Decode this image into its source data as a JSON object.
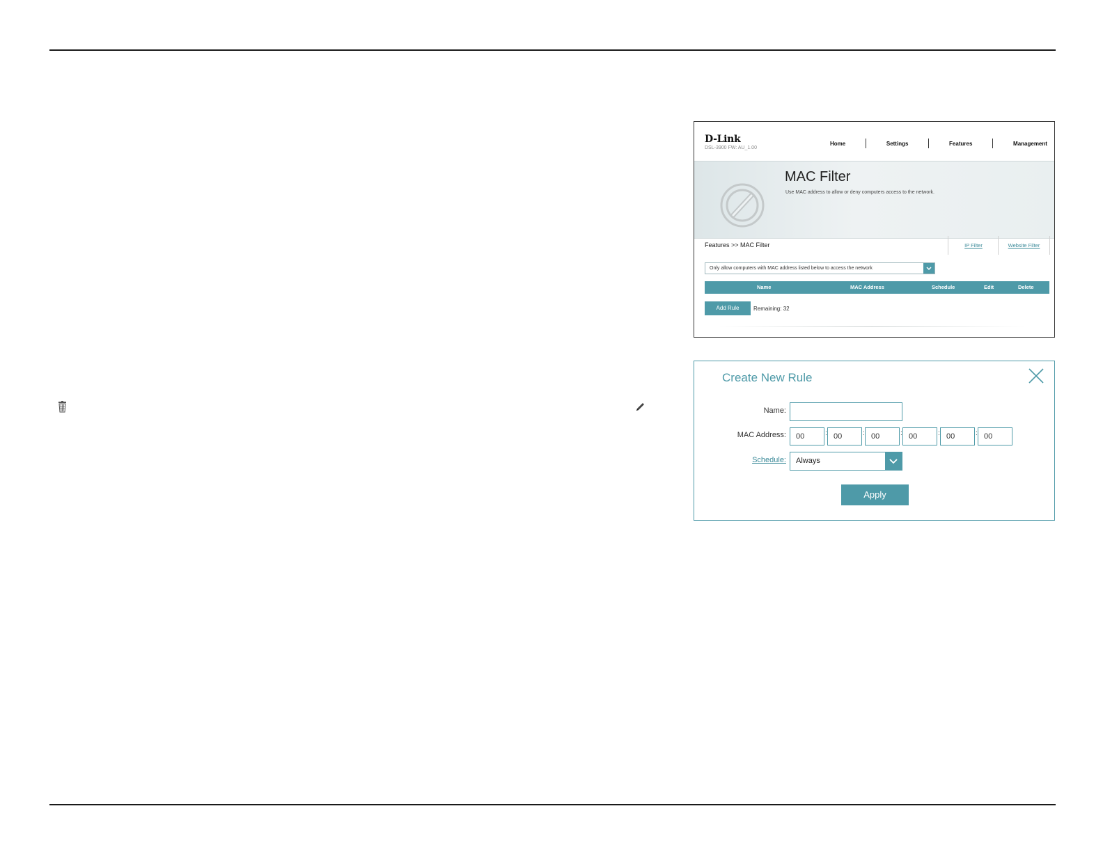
{
  "shot1": {
    "brand": "D-Link",
    "model": "DSL-3900   FW: AU_1.00",
    "nav": [
      "Home",
      "Settings",
      "Features",
      "Management"
    ],
    "hero": {
      "title": "MAC Filter",
      "description": "Use MAC address to allow or deny computers access to the network."
    },
    "breadcrumb": "Features >> MAC Filter",
    "tabs": {
      "ip_filter": "IP Filter",
      "website_filter": "Website Filter"
    },
    "mode_select": "Only allow computers with MAC address listed below to access the network",
    "table_headers": [
      "Name",
      "MAC Address",
      "Schedule",
      "Edit",
      "Delete"
    ],
    "add_rule": "Add Rule",
    "remaining": "Remaining: 32"
  },
  "shot2": {
    "title": "Create New Rule",
    "labels": {
      "name": "Name:",
      "mac": "MAC Address:",
      "schedule": "Schedule:"
    },
    "name_value": "",
    "mac_octets": [
      "00",
      "00",
      "00",
      "00",
      "00",
      "00"
    ],
    "mac_separator": ":",
    "schedule_value": "Always",
    "apply": "Apply"
  },
  "icons": {
    "left": "trash-icon",
    "right": "pencil-icon",
    "close": "close-icon",
    "hero": "blocked-icon"
  },
  "colors": {
    "accent": "#4e9aa8",
    "link": "#3b8a99"
  }
}
